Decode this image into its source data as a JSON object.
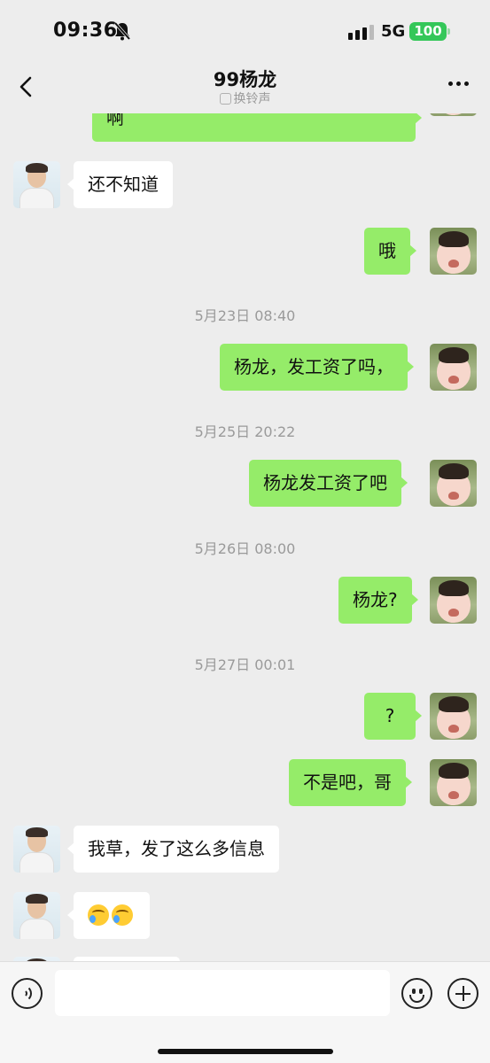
{
  "status_bar": {
    "time": "09:36",
    "network": "5G",
    "battery": "100",
    "bell_icon": "bell-slash-icon"
  },
  "header": {
    "title": "99杨龙",
    "subtitle": "换铃声",
    "back_icon": "chevron-left-icon",
    "more_icon": "ellipsis-icon"
  },
  "messages": [
    {
      "side": "out",
      "text": "啊"
    },
    {
      "side": "in",
      "text": "还不知道"
    },
    {
      "side": "out",
      "text": "哦"
    },
    {
      "type": "timestamp",
      "text": "5月23日 08:40"
    },
    {
      "side": "out",
      "text": "杨龙，发工资了吗，"
    },
    {
      "type": "timestamp",
      "text": "5月25日 20:22"
    },
    {
      "side": "out",
      "text": "杨龙发工资了吧"
    },
    {
      "type": "timestamp",
      "text": "5月26日 08:00"
    },
    {
      "side": "out",
      "text": "杨龙?"
    },
    {
      "type": "timestamp",
      "text": "5月27日 00:01"
    },
    {
      "side": "out",
      "text": "?"
    },
    {
      "side": "out",
      "text": "不是吧，哥"
    },
    {
      "side": "in",
      "text": "我草，发了这么多信息"
    },
    {
      "side": "in",
      "text": "",
      "emoji": [
        "face-with-tears-of-joy-icon",
        "face-with-tears-of-joy-icon"
      ]
    }
  ],
  "input_bar": {
    "voice_icon": "voice-input-icon",
    "text_value": "",
    "emoji_icon": "smiley-icon",
    "plus_icon": "plus-circle-icon"
  },
  "colors": {
    "background": "#ededed",
    "outgoing_bubble": "#95ec69",
    "incoming_bubble": "#ffffff",
    "battery": "#34c759"
  }
}
